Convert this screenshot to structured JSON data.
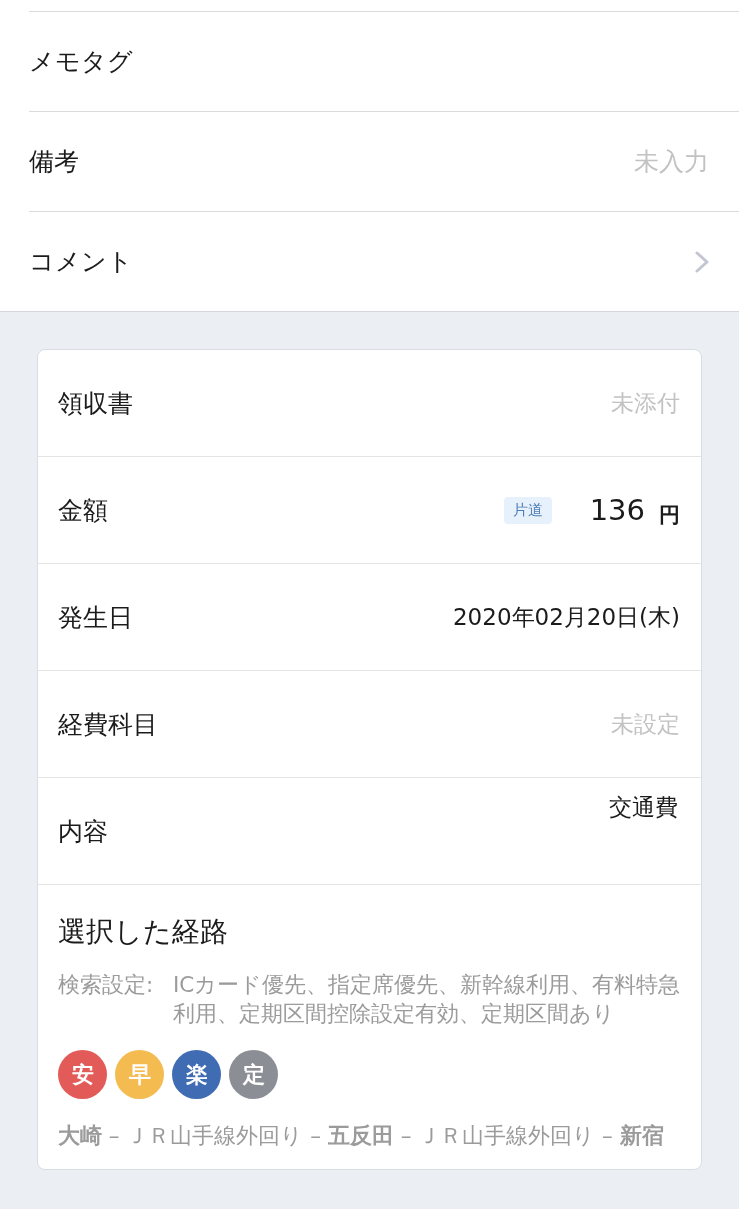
{
  "memo_rows": [
    {
      "kind": "plain",
      "label": "メモタグ"
    },
    {
      "kind": "value",
      "label": "備考",
      "value": "未入力",
      "unset": true
    },
    {
      "kind": "link",
      "label": "コメント"
    }
  ],
  "card_rows": [
    {
      "kind": "value",
      "label": "領収書",
      "value": "未添付",
      "unset": true
    },
    {
      "kind": "amount",
      "label": "金額",
      "badge": "片道",
      "amount": "136",
      "unit": "円"
    },
    {
      "kind": "value",
      "label": "発生日",
      "value": "2020年02月20日(木)",
      "unset": false
    },
    {
      "kind": "value",
      "label": "経費科目",
      "value": "未設定",
      "unset": true
    },
    {
      "kind": "top_value",
      "label": "内容",
      "value": "交通費",
      "unset": false
    }
  ],
  "route": {
    "title": "選択した経路",
    "settings_label": "検索設定:",
    "settings": "ICカード優先、指定席優先、新幹線利用、有料特急利用、定期区間控除設定有効、定期区間あり",
    "tags": [
      {
        "label": "安",
        "color": "#e35b58"
      },
      {
        "label": "早",
        "color": "#f3bb50"
      },
      {
        "label": "楽",
        "color": "#3f6cb2"
      },
      {
        "label": "定",
        "color": "#8b8e94"
      }
    ],
    "path": "**大崎** – ＪＲ山手線外回り – **五反田** – ＪＲ山手線外回り – **新宿**"
  }
}
